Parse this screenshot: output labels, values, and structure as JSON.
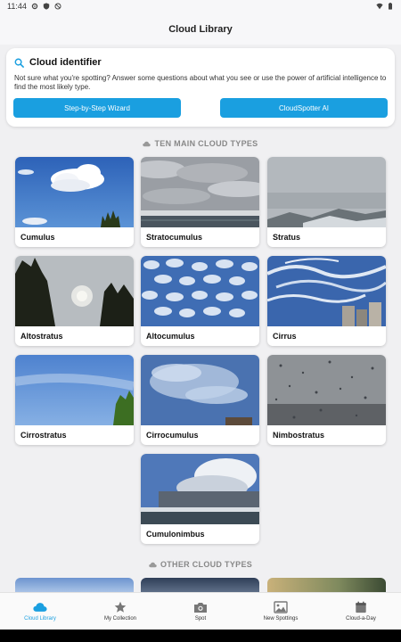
{
  "status": {
    "time": "11:44"
  },
  "header": {
    "title": "Cloud Library"
  },
  "identifier": {
    "title": "Cloud identifier",
    "description": "Not sure what you're spotting? Answer some questions about what you see or use the power of artificial intelligence to find the most likely type.",
    "wizard_label": "Step-by-Step Wizard",
    "ai_label": "CloudSpotter AI"
  },
  "sections": {
    "main_title": "TEN MAIN CLOUD TYPES",
    "other_title": "OTHER CLOUD TYPES"
  },
  "clouds": [
    {
      "name": "Cumulus"
    },
    {
      "name": "Stratocumulus"
    },
    {
      "name": "Stratus"
    },
    {
      "name": "Altostratus"
    },
    {
      "name": "Altocumulus"
    },
    {
      "name": "Cirrus"
    },
    {
      "name": "Cirrostratus"
    },
    {
      "name": "Cirrocumulus"
    },
    {
      "name": "Nimbostratus"
    },
    {
      "name": "Cumulonimbus"
    }
  ],
  "nav": [
    {
      "label": "Cloud Library",
      "icon": "cloud-icon",
      "active": true
    },
    {
      "label": "My Collection",
      "icon": "star-icon"
    },
    {
      "label": "Spot",
      "icon": "camera-icon"
    },
    {
      "label": "New Spottings",
      "icon": "image-icon"
    },
    {
      "label": "Cloud-a-Day",
      "icon": "calendar-icon"
    }
  ],
  "colors": {
    "accent": "#1a9fe0",
    "background": "#f0f0f2"
  }
}
